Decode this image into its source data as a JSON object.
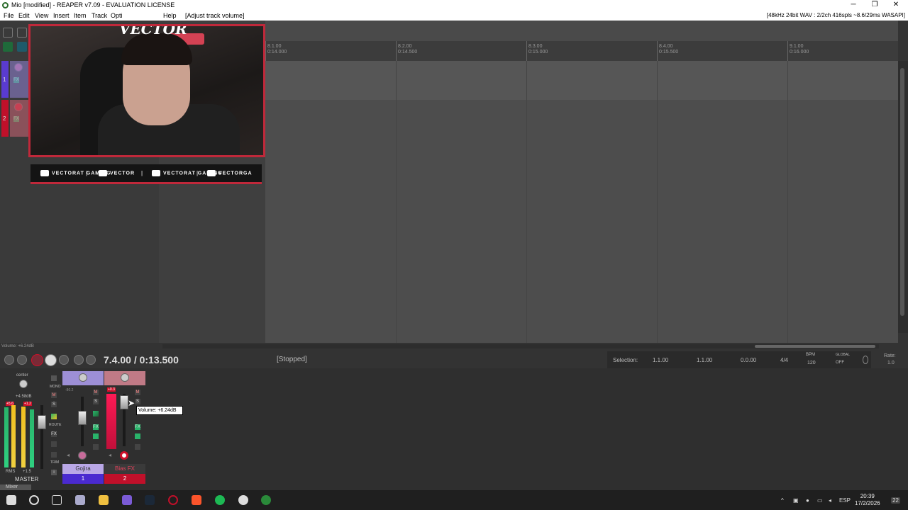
{
  "window": {
    "title": "Mio [modified] - REAPER v7.09 - EVALUATION LICENSE",
    "minimize_glyph": "─",
    "restore_glyph": "❐",
    "close_glyph": "✕"
  },
  "menubar": {
    "items": [
      "File",
      "Edit",
      "View",
      "Insert",
      "Item",
      "Track",
      "Opti",
      "Help"
    ],
    "action_hint": "[Adjust track volume]",
    "audio_status": "[48kHz 24bit WAV : 2/2ch 416spls ~8.6/29ms WASAPI]"
  },
  "tracks": [
    {
      "number": "1",
      "name": "Gojira",
      "color": "#7b5bd6",
      "fx_label": "FX"
    },
    {
      "number": "2",
      "name": "Bias FX",
      "color": "#d0102a",
      "fx_label": "FX"
    }
  ],
  "ruler": {
    "marks": [
      {
        "bar": "8.1.00",
        "time": "0:14.000"
      },
      {
        "bar": "8.2.00",
        "time": "0:14.500"
      },
      {
        "bar": "8.3.00",
        "time": "0:15.000"
      },
      {
        "bar": "8.4.00",
        "time": "0:15.500"
      },
      {
        "bar": "9.1.00",
        "time": "0:16.000"
      }
    ]
  },
  "overlay": {
    "logo_text": "VECTOR",
    "social": [
      {
        "icon": "youtube-icon",
        "label": "VECTORAT GAMING"
      },
      {
        "icon": "twitch-icon",
        "label": "VECTOR"
      },
      {
        "icon": "twitter-icon",
        "label": "VECTORAT GAMING"
      },
      {
        "icon": "instagram-icon",
        "label": "VECTORGA"
      }
    ],
    "separator": "|"
  },
  "transport": {
    "position": "7.4.00 / 0:13.500",
    "state": "[Stopped]",
    "volume_status": "Volume: +6.24dB"
  },
  "selection": {
    "label": "Selection:",
    "start": "1.1.00",
    "end": "1.1.00",
    "length": "0.0.00",
    "time_sig": "4/4",
    "bpm_label": "BPM",
    "bpm": "120",
    "global_label": "GLOBAL",
    "global_state": "OFF",
    "rate_label": "Rate:",
    "rate": "1.0"
  },
  "mixer": {
    "label": "Mixer",
    "master_label": "MASTER",
    "master_pan": "center",
    "master_peak": "+4.58dB",
    "master_meter_left": "+5.6",
    "master_meter_right": "+1.2",
    "master_rms_label": "RMS",
    "master_rms": "+1.5",
    "mono_label": "MONO",
    "route_label": "ROUTE",
    "trim_label": "TRIM",
    "track1_volume": "-80.2",
    "track2_peak": "+0.3",
    "tooltip": "Volume: +6.24dB"
  },
  "taskbar": {
    "language": "ESP",
    "time": "20:39",
    "date": "17/2/2026",
    "notification_count": "22"
  },
  "colors": {
    "overlay_border": "#c0283a",
    "track1": "#7b5bd6",
    "track2": "#d0102a",
    "fx_green": "#29b36a"
  }
}
